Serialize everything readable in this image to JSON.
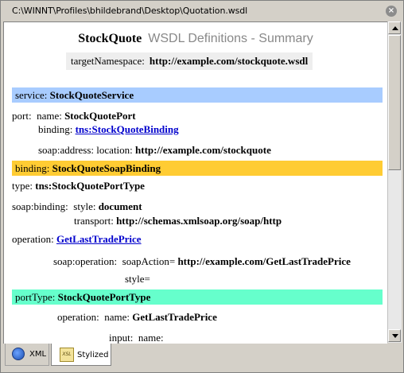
{
  "window": {
    "title": "C:\\WINNT\\Profiles\\bhildebrand\\Desktop\\Quotation.wsdl"
  },
  "header": {
    "name": "StockQuote",
    "subtitle": "WSDL Definitions - Summary",
    "tns_label": "targetNamespace:",
    "tns_value": "http://example.com/stockquote.wsdl"
  },
  "service": {
    "label": "service:",
    "name": "StockQuoteService",
    "port_label": "port:",
    "name_label": "name:",
    "port_name": "StockQuotePort",
    "binding_label": "binding:",
    "binding_link": "tns:StockQuoteBinding",
    "soap_address_label": "soap:address:",
    "location_label": "location:",
    "location_value": "http://example.com/stockquote"
  },
  "binding": {
    "label": "binding:",
    "name": "StockQuoteSoapBinding",
    "type_label": "type:",
    "type_value": "tns:StockQuotePortType",
    "soap_binding_label": "soap:binding:",
    "style_label": "style:",
    "style_value": "document",
    "transport_label": "transport:",
    "transport_value": "http://schemas.xmlsoap.org/soap/http",
    "operation_label": "operation:",
    "operation_link": "GetLastTradePrice",
    "soap_operation_label": "soap:operation:",
    "soap_action_label": "soapAction=",
    "soap_action_value": "http://example.com/GetLastTradePrice",
    "style_eq_label": "style="
  },
  "porttype": {
    "label": "portType:",
    "name": "StockQuotePortType",
    "operation_label": "operation:",
    "name_label": "name:",
    "operation_name": "GetLastTradePrice",
    "input_label": "input:",
    "input_name_label": "name:"
  },
  "tabs": [
    {
      "label": "XML",
      "icon": "globe-icon"
    },
    {
      "label": "Stylized",
      "icon": "xsl-icon"
    }
  ],
  "colors": {
    "service_band": "#a8ccff",
    "binding_band": "#ffcc33",
    "porttype_band": "#66ffcc"
  }
}
